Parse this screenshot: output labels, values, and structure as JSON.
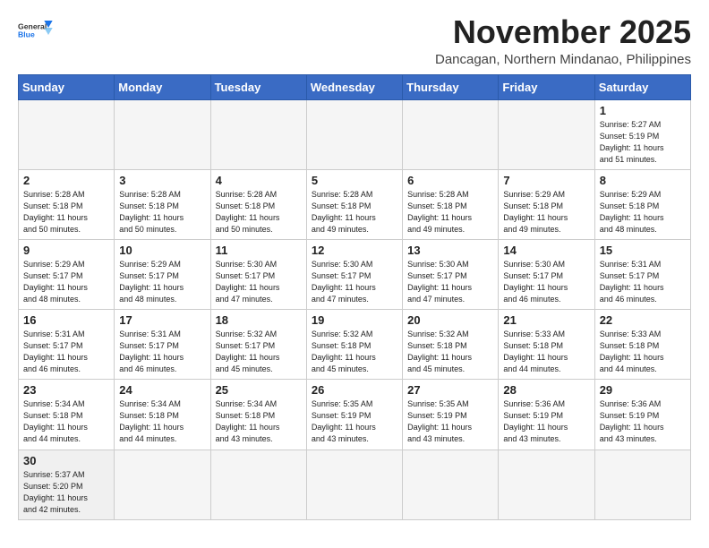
{
  "header": {
    "title": "November 2025",
    "subtitle": "Dancagan, Northern Mindanao, Philippines",
    "logo_general": "General",
    "logo_blue": "Blue"
  },
  "weekdays": [
    "Sunday",
    "Monday",
    "Tuesday",
    "Wednesday",
    "Thursday",
    "Friday",
    "Saturday"
  ],
  "weeks": [
    [
      {
        "date": "",
        "info": ""
      },
      {
        "date": "",
        "info": ""
      },
      {
        "date": "",
        "info": ""
      },
      {
        "date": "",
        "info": ""
      },
      {
        "date": "",
        "info": ""
      },
      {
        "date": "",
        "info": ""
      },
      {
        "date": "1",
        "info": "Sunrise: 5:27 AM\nSunset: 5:19 PM\nDaylight: 11 hours\nand 51 minutes."
      }
    ],
    [
      {
        "date": "2",
        "info": "Sunrise: 5:28 AM\nSunset: 5:18 PM\nDaylight: 11 hours\nand 50 minutes."
      },
      {
        "date": "3",
        "info": "Sunrise: 5:28 AM\nSunset: 5:18 PM\nDaylight: 11 hours\nand 50 minutes."
      },
      {
        "date": "4",
        "info": "Sunrise: 5:28 AM\nSunset: 5:18 PM\nDaylight: 11 hours\nand 50 minutes."
      },
      {
        "date": "5",
        "info": "Sunrise: 5:28 AM\nSunset: 5:18 PM\nDaylight: 11 hours\nand 49 minutes."
      },
      {
        "date": "6",
        "info": "Sunrise: 5:28 AM\nSunset: 5:18 PM\nDaylight: 11 hours\nand 49 minutes."
      },
      {
        "date": "7",
        "info": "Sunrise: 5:29 AM\nSunset: 5:18 PM\nDaylight: 11 hours\nand 49 minutes."
      },
      {
        "date": "8",
        "info": "Sunrise: 5:29 AM\nSunset: 5:18 PM\nDaylight: 11 hours\nand 48 minutes."
      }
    ],
    [
      {
        "date": "9",
        "info": "Sunrise: 5:29 AM\nSunset: 5:17 PM\nDaylight: 11 hours\nand 48 minutes."
      },
      {
        "date": "10",
        "info": "Sunrise: 5:29 AM\nSunset: 5:17 PM\nDaylight: 11 hours\nand 48 minutes."
      },
      {
        "date": "11",
        "info": "Sunrise: 5:30 AM\nSunset: 5:17 PM\nDaylight: 11 hours\nand 47 minutes."
      },
      {
        "date": "12",
        "info": "Sunrise: 5:30 AM\nSunset: 5:17 PM\nDaylight: 11 hours\nand 47 minutes."
      },
      {
        "date": "13",
        "info": "Sunrise: 5:30 AM\nSunset: 5:17 PM\nDaylight: 11 hours\nand 47 minutes."
      },
      {
        "date": "14",
        "info": "Sunrise: 5:30 AM\nSunset: 5:17 PM\nDaylight: 11 hours\nand 46 minutes."
      },
      {
        "date": "15",
        "info": "Sunrise: 5:31 AM\nSunset: 5:17 PM\nDaylight: 11 hours\nand 46 minutes."
      }
    ],
    [
      {
        "date": "16",
        "info": "Sunrise: 5:31 AM\nSunset: 5:17 PM\nDaylight: 11 hours\nand 46 minutes."
      },
      {
        "date": "17",
        "info": "Sunrise: 5:31 AM\nSunset: 5:17 PM\nDaylight: 11 hours\nand 46 minutes."
      },
      {
        "date": "18",
        "info": "Sunrise: 5:32 AM\nSunset: 5:17 PM\nDaylight: 11 hours\nand 45 minutes."
      },
      {
        "date": "19",
        "info": "Sunrise: 5:32 AM\nSunset: 5:18 PM\nDaylight: 11 hours\nand 45 minutes."
      },
      {
        "date": "20",
        "info": "Sunrise: 5:32 AM\nSunset: 5:18 PM\nDaylight: 11 hours\nand 45 minutes."
      },
      {
        "date": "21",
        "info": "Sunrise: 5:33 AM\nSunset: 5:18 PM\nDaylight: 11 hours\nand 44 minutes."
      },
      {
        "date": "22",
        "info": "Sunrise: 5:33 AM\nSunset: 5:18 PM\nDaylight: 11 hours\nand 44 minutes."
      }
    ],
    [
      {
        "date": "23",
        "info": "Sunrise: 5:34 AM\nSunset: 5:18 PM\nDaylight: 11 hours\nand 44 minutes."
      },
      {
        "date": "24",
        "info": "Sunrise: 5:34 AM\nSunset: 5:18 PM\nDaylight: 11 hours\nand 44 minutes."
      },
      {
        "date": "25",
        "info": "Sunrise: 5:34 AM\nSunset: 5:18 PM\nDaylight: 11 hours\nand 43 minutes."
      },
      {
        "date": "26",
        "info": "Sunrise: 5:35 AM\nSunset: 5:19 PM\nDaylight: 11 hours\nand 43 minutes."
      },
      {
        "date": "27",
        "info": "Sunrise: 5:35 AM\nSunset: 5:19 PM\nDaylight: 11 hours\nand 43 minutes."
      },
      {
        "date": "28",
        "info": "Sunrise: 5:36 AM\nSunset: 5:19 PM\nDaylight: 11 hours\nand 43 minutes."
      },
      {
        "date": "29",
        "info": "Sunrise: 5:36 AM\nSunset: 5:19 PM\nDaylight: 11 hours\nand 43 minutes."
      }
    ],
    [
      {
        "date": "30",
        "info": "Sunrise: 5:37 AM\nSunset: 5:20 PM\nDaylight: 11 hours\nand 42 minutes."
      },
      {
        "date": "",
        "info": ""
      },
      {
        "date": "",
        "info": ""
      },
      {
        "date": "",
        "info": ""
      },
      {
        "date": "",
        "info": ""
      },
      {
        "date": "",
        "info": ""
      },
      {
        "date": "",
        "info": ""
      }
    ]
  ]
}
